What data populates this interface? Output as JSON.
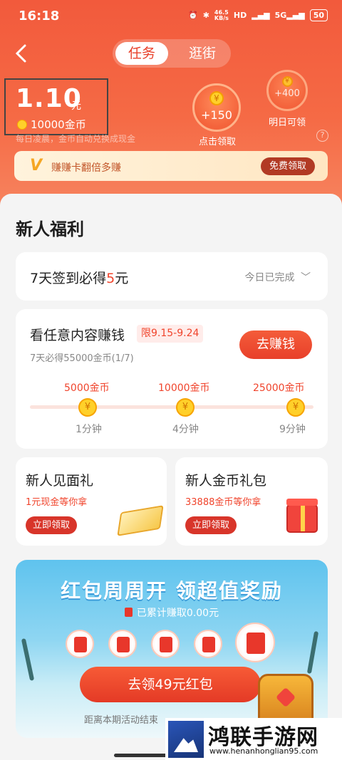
{
  "status_bar": {
    "time": "16:18",
    "net_speed": "46.5\nKB/s",
    "battery": "50"
  },
  "tabs": [
    {
      "label": "任务",
      "active": true
    },
    {
      "label": "逛街",
      "active": false
    }
  ],
  "wallet": {
    "balance": "1.10",
    "unit": "元",
    "coins": "10000金币",
    "hint": "每日凌晨，金币自动兑换成现金"
  },
  "bubbles": [
    {
      "value": "+150",
      "label": "点击领取"
    },
    {
      "value": "+400",
      "label": "明日可领"
    }
  ],
  "promo": {
    "icon": "V",
    "text": "赚赚卡翻倍多赚",
    "button": "免费领取"
  },
  "section_title": "新人福利",
  "signin": {
    "prefix": "7天签到必得",
    "amount": "5",
    "suffix": "元",
    "status": "今日已完成"
  },
  "task": {
    "title": "看任意内容赚钱",
    "tag": "限9.15-9.24",
    "subtitle": "7天必得55000金币(1/7)",
    "button": "去赚钱",
    "milestones": [
      {
        "amount": "5000金币",
        "time": "1分钟"
      },
      {
        "amount": "10000金币",
        "time": "4分钟"
      },
      {
        "amount": "25000金币",
        "time": "9分钟"
      }
    ]
  },
  "gifts": [
    {
      "title": "新人见面礼",
      "subtitle": "1元现金等你拿",
      "button": "立即领取"
    },
    {
      "title": "新人金币礼包",
      "subtitle": "33888金币等你拿",
      "button": "立即领取"
    }
  ],
  "banner": {
    "title": "红包周周开 领超值奖励",
    "accumulated": "已累计赚取0.00元",
    "button": "去领49元红包",
    "footer": "距离本期活动结束"
  },
  "watermark": {
    "title": "鸿联手游网",
    "url": "www.henanhonglian95.com"
  },
  "colors": {
    "accent": "#f0442c",
    "header": "#f25a3c",
    "coin": "#ffd02a"
  },
  "icons": {
    "back": "chevron-left-icon",
    "help": "question-icon",
    "coin": "yen-coin-icon"
  }
}
